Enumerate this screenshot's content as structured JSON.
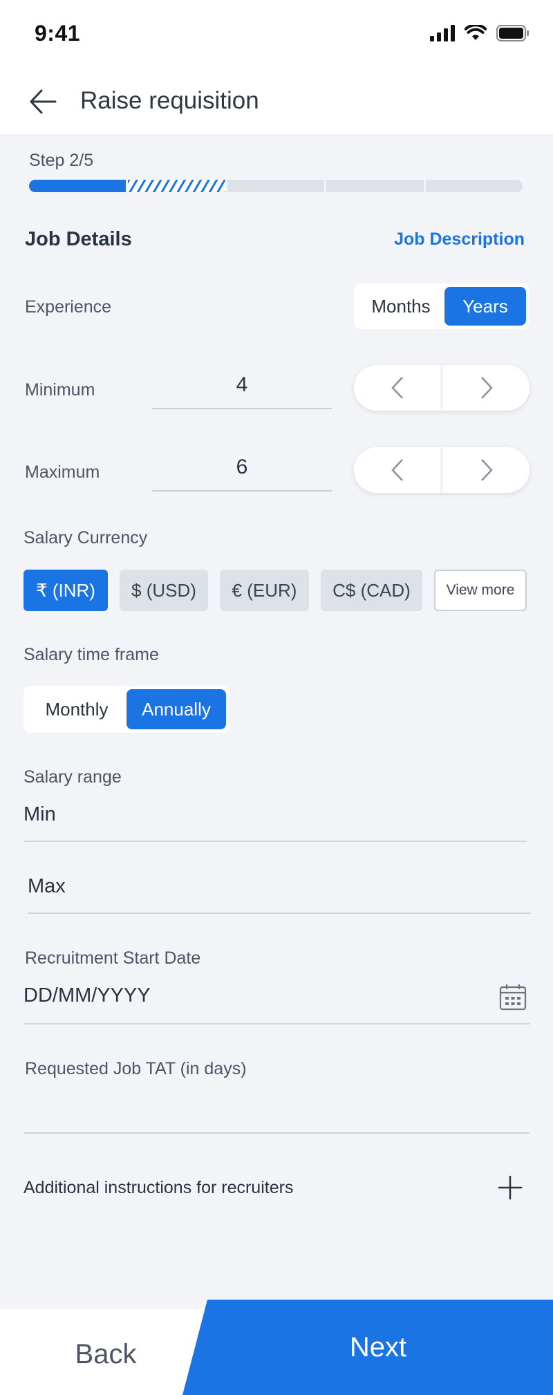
{
  "status_bar": {
    "time": "9:41",
    "icons": [
      "cellular-signal-icon",
      "wifi-icon",
      "battery-icon"
    ]
  },
  "header": {
    "title": "Raise requisition",
    "back_icon": "arrow-left-icon"
  },
  "progress": {
    "step_label": "Step 2/5",
    "current_step": 2,
    "total_steps": 5
  },
  "job_details": {
    "section_title": "Job Details",
    "job_description_link": "Job Description",
    "experience": {
      "label": "Experience",
      "unit_options": [
        "Months",
        "Years"
      ],
      "selected_unit": "Years",
      "minimum": {
        "label": "Minimum",
        "value": "4"
      },
      "maximum": {
        "label": "Maximum",
        "value": "6"
      }
    },
    "salary_currency": {
      "label": "Salary Currency",
      "options": [
        "₹ (INR)",
        "$ (USD)",
        "€ (EUR)",
        "C$ (CAD)"
      ],
      "selected": "₹ (INR)",
      "view_more": "View more"
    },
    "salary_time_frame": {
      "label": "Salary time frame",
      "options": [
        "Monthly",
        "Annually"
      ],
      "selected": "Annually"
    },
    "salary_range": {
      "label": "Salary range",
      "min_placeholder": "Min",
      "max_placeholder": "Max"
    },
    "recruitment_start_date": {
      "label": "Recruitment Start Date",
      "placeholder": "DD/MM/YYYY"
    },
    "requested_job_tat": {
      "label": "Requested Job TAT (in days)",
      "value": ""
    },
    "additional_instructions": {
      "label": "Additional instructions for recruiters"
    }
  },
  "footer": {
    "back_label": "Back",
    "next_label": "Next"
  },
  "colors": {
    "primary": "#1b74e4",
    "background": "#f2f4f7",
    "chip_inactive": "#dde2e9"
  }
}
